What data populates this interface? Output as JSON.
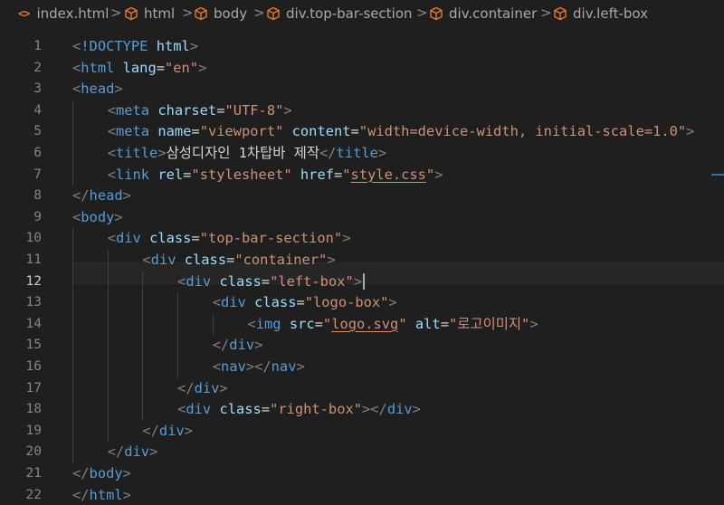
{
  "breadcrumb": [
    {
      "label": "index.html",
      "icon": "html-file-icon"
    },
    {
      "label": "html",
      "icon": "element-cube-icon"
    },
    {
      "label": "body",
      "icon": "element-cube-icon"
    },
    {
      "label": "div.top-bar-section",
      "icon": "element-cube-icon"
    },
    {
      "label": "div.container",
      "icon": "element-cube-icon"
    },
    {
      "label": "div.left-box",
      "icon": "element-cube-icon"
    }
  ],
  "separator": ">",
  "html_icon_glyph": "<>",
  "colors": {
    "tag": "#569cd6",
    "attr": "#9cdcfe",
    "string": "#ce9178",
    "punct": "#808080",
    "text": "#d4d4d4",
    "cube_icon": "#e37933"
  },
  "active_line": 12,
  "lines": [
    {
      "n": "1",
      "indent": 0,
      "tokens": [
        [
          "p",
          "<"
        ],
        [
          "t",
          "!DOCTYPE"
        ],
        [
          "tx",
          " "
        ],
        [
          "a",
          "html"
        ],
        [
          "p",
          ">"
        ]
      ]
    },
    {
      "n": "2",
      "indent": 0,
      "tokens": [
        [
          "p",
          "<"
        ],
        [
          "t",
          "html"
        ],
        [
          "tx",
          " "
        ],
        [
          "a",
          "lang"
        ],
        [
          "tx",
          "="
        ],
        [
          "s",
          "\"en\""
        ],
        [
          "p",
          ">"
        ]
      ]
    },
    {
      "n": "3",
      "indent": 0,
      "tokens": [
        [
          "p",
          "<"
        ],
        [
          "t",
          "head"
        ],
        [
          "p",
          ">"
        ]
      ]
    },
    {
      "n": "4",
      "indent": 1,
      "tokens": [
        [
          "p",
          "<"
        ],
        [
          "t",
          "meta"
        ],
        [
          "tx",
          " "
        ],
        [
          "a",
          "charset"
        ],
        [
          "tx",
          "="
        ],
        [
          "s",
          "\"UTF-8\""
        ],
        [
          "p",
          ">"
        ]
      ]
    },
    {
      "n": "5",
      "indent": 1,
      "tokens": [
        [
          "p",
          "<"
        ],
        [
          "t",
          "meta"
        ],
        [
          "tx",
          " "
        ],
        [
          "a",
          "name"
        ],
        [
          "tx",
          "="
        ],
        [
          "s",
          "\"viewport\""
        ],
        [
          "tx",
          " "
        ],
        [
          "a",
          "content"
        ],
        [
          "tx",
          "="
        ],
        [
          "s",
          "\"width=device-width, initial-scale=1.0\""
        ],
        [
          "p",
          ">"
        ]
      ]
    },
    {
      "n": "6",
      "indent": 1,
      "tokens": [
        [
          "p",
          "<"
        ],
        [
          "t",
          "title"
        ],
        [
          "p",
          ">"
        ],
        [
          "tx",
          "삼성디자인 1차탑바 제작"
        ],
        [
          "p",
          "</"
        ],
        [
          "t",
          "title"
        ],
        [
          "p",
          ">"
        ]
      ]
    },
    {
      "n": "7",
      "indent": 1,
      "tokens": [
        [
          "p",
          "<"
        ],
        [
          "t",
          "link"
        ],
        [
          "tx",
          " "
        ],
        [
          "a",
          "rel"
        ],
        [
          "tx",
          "="
        ],
        [
          "s",
          "\"stylesheet\""
        ],
        [
          "tx",
          " "
        ],
        [
          "a",
          "href"
        ],
        [
          "tx",
          "="
        ],
        [
          "s",
          "\""
        ],
        [
          "sl",
          "style.css"
        ],
        [
          "s",
          "\""
        ],
        [
          "p",
          ">"
        ]
      ]
    },
    {
      "n": "8",
      "indent": 0,
      "tokens": [
        [
          "p",
          "</"
        ],
        [
          "t",
          "head"
        ],
        [
          "p",
          ">"
        ]
      ]
    },
    {
      "n": "9",
      "indent": 0,
      "tokens": [
        [
          "p",
          "<"
        ],
        [
          "t",
          "body"
        ],
        [
          "p",
          ">"
        ]
      ]
    },
    {
      "n": "10",
      "indent": 1,
      "tokens": [
        [
          "p",
          "<"
        ],
        [
          "t",
          "div"
        ],
        [
          "tx",
          " "
        ],
        [
          "a",
          "class"
        ],
        [
          "tx",
          "="
        ],
        [
          "s",
          "\"top-bar-section\""
        ],
        [
          "p",
          ">"
        ]
      ]
    },
    {
      "n": "11",
      "indent": 2,
      "tokens": [
        [
          "p",
          "<"
        ],
        [
          "t",
          "div"
        ],
        [
          "tx",
          " "
        ],
        [
          "a",
          "class"
        ],
        [
          "tx",
          "="
        ],
        [
          "s",
          "\"container\""
        ],
        [
          "p",
          ">"
        ]
      ]
    },
    {
      "n": "12",
      "indent": 3,
      "tokens": [
        [
          "p",
          "<"
        ],
        [
          "t",
          "div"
        ],
        [
          "tx",
          " "
        ],
        [
          "a",
          "class"
        ],
        [
          "tx",
          "="
        ],
        [
          "s",
          "\"left-box\""
        ],
        [
          "p",
          ">"
        ]
      ],
      "caret": true
    },
    {
      "n": "13",
      "indent": 4,
      "tokens": [
        [
          "p",
          "<"
        ],
        [
          "t",
          "div"
        ],
        [
          "tx",
          " "
        ],
        [
          "a",
          "class"
        ],
        [
          "tx",
          "="
        ],
        [
          "s",
          "\"logo-box\""
        ],
        [
          "p",
          ">"
        ]
      ]
    },
    {
      "n": "14",
      "indent": 5,
      "tokens": [
        [
          "p",
          "<"
        ],
        [
          "t",
          "img"
        ],
        [
          "tx",
          " "
        ],
        [
          "a",
          "src"
        ],
        [
          "tx",
          "="
        ],
        [
          "s",
          "\""
        ],
        [
          "sl",
          "logo.svg"
        ],
        [
          "s",
          "\""
        ],
        [
          "tx",
          " "
        ],
        [
          "a",
          "alt"
        ],
        [
          "tx",
          "="
        ],
        [
          "s",
          "\"로고이미지\""
        ],
        [
          "p",
          ">"
        ]
      ]
    },
    {
      "n": "15",
      "indent": 4,
      "tokens": [
        [
          "p",
          "</"
        ],
        [
          "t",
          "div"
        ],
        [
          "p",
          ">"
        ]
      ]
    },
    {
      "n": "16",
      "indent": 4,
      "tokens": [
        [
          "p",
          "<"
        ],
        [
          "t",
          "nav"
        ],
        [
          "p",
          "></"
        ],
        [
          "t",
          "nav"
        ],
        [
          "p",
          ">"
        ]
      ]
    },
    {
      "n": "17",
      "indent": 3,
      "tokens": [
        [
          "p",
          "</"
        ],
        [
          "t",
          "div"
        ],
        [
          "p",
          ">"
        ]
      ]
    },
    {
      "n": "18",
      "indent": 3,
      "tokens": [
        [
          "p",
          "<"
        ],
        [
          "t",
          "div"
        ],
        [
          "tx",
          " "
        ],
        [
          "a",
          "class"
        ],
        [
          "tx",
          "="
        ],
        [
          "s",
          "\"right-box\""
        ],
        [
          "p",
          "></"
        ],
        [
          "t",
          "div"
        ],
        [
          "p",
          ">"
        ]
      ]
    },
    {
      "n": "19",
      "indent": 2,
      "tokens": [
        [
          "p",
          "</"
        ],
        [
          "t",
          "div"
        ],
        [
          "p",
          ">"
        ]
      ]
    },
    {
      "n": "20",
      "indent": 1,
      "tokens": [
        [
          "p",
          "</"
        ],
        [
          "t",
          "div"
        ],
        [
          "p",
          ">"
        ]
      ]
    },
    {
      "n": "21",
      "indent": 0,
      "tokens": [
        [
          "p",
          "</"
        ],
        [
          "t",
          "body"
        ],
        [
          "p",
          ">"
        ]
      ]
    },
    {
      "n": "22",
      "indent": 0,
      "tokens": [
        [
          "p",
          "</"
        ],
        [
          "t",
          "html"
        ],
        [
          "p",
          ">"
        ]
      ]
    }
  ]
}
